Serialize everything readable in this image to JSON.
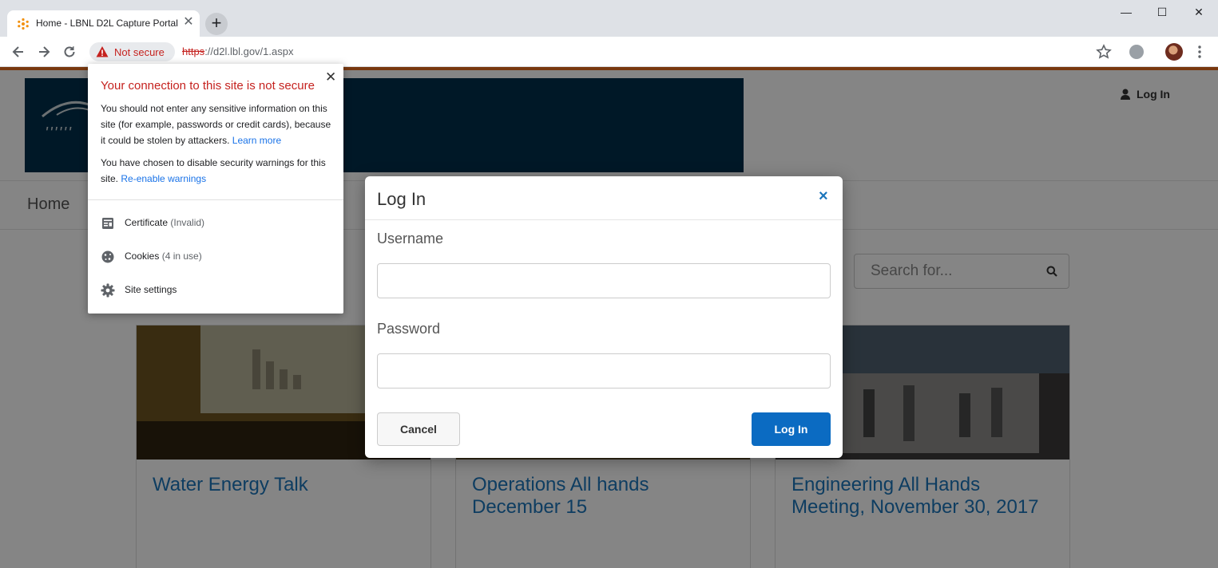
{
  "browser": {
    "tab_title": "Home - LBNL D2L Capture Portal",
    "tab_close": "✕",
    "new_tab": "+",
    "security_label": "Not secure",
    "url_scheme": "https",
    "url_rest": "://d2l.lbl.gov/1.aspx",
    "window_controls": {
      "minimize": "—",
      "maximize": "☐",
      "close": "✕"
    }
  },
  "site": {
    "header_login": "Log In",
    "nav_home": "Home",
    "search_placeholder": "Search for...",
    "cards": [
      {
        "title": "Water Energy Talk"
      },
      {
        "title": "Operations All hands December 15"
      },
      {
        "title": "Engineering All Hands Meeting, November 30, 2017"
      }
    ],
    "colors": {
      "accent": "#e66b1d",
      "banner": "#002f4b",
      "link": "#1b75bb"
    }
  },
  "login_modal": {
    "title": "Log In",
    "close": "×",
    "username_label": "Username",
    "username_value": "",
    "password_label": "Password",
    "password_value": "",
    "cancel_label": "Cancel",
    "submit_label": "Log In"
  },
  "site_info_popup": {
    "heading": "Your connection to this site is not secure",
    "close": "✕",
    "warning_text": "You should not enter any sensitive information on this site (for example, passwords or credit cards), because it could be stolen by attackers.",
    "learn_more": "Learn more",
    "disabled_text": "You have chosen to disable security warnings for this site.",
    "reenable": "Re-enable warnings",
    "items": [
      {
        "label": "Certificate",
        "sub": "(Invalid)",
        "icon": "certificate-icon"
      },
      {
        "label": "Cookies",
        "sub": "(4 in use)",
        "icon": "cookie-icon"
      },
      {
        "label": "Site settings",
        "sub": "",
        "icon": "gear-icon"
      }
    ]
  }
}
